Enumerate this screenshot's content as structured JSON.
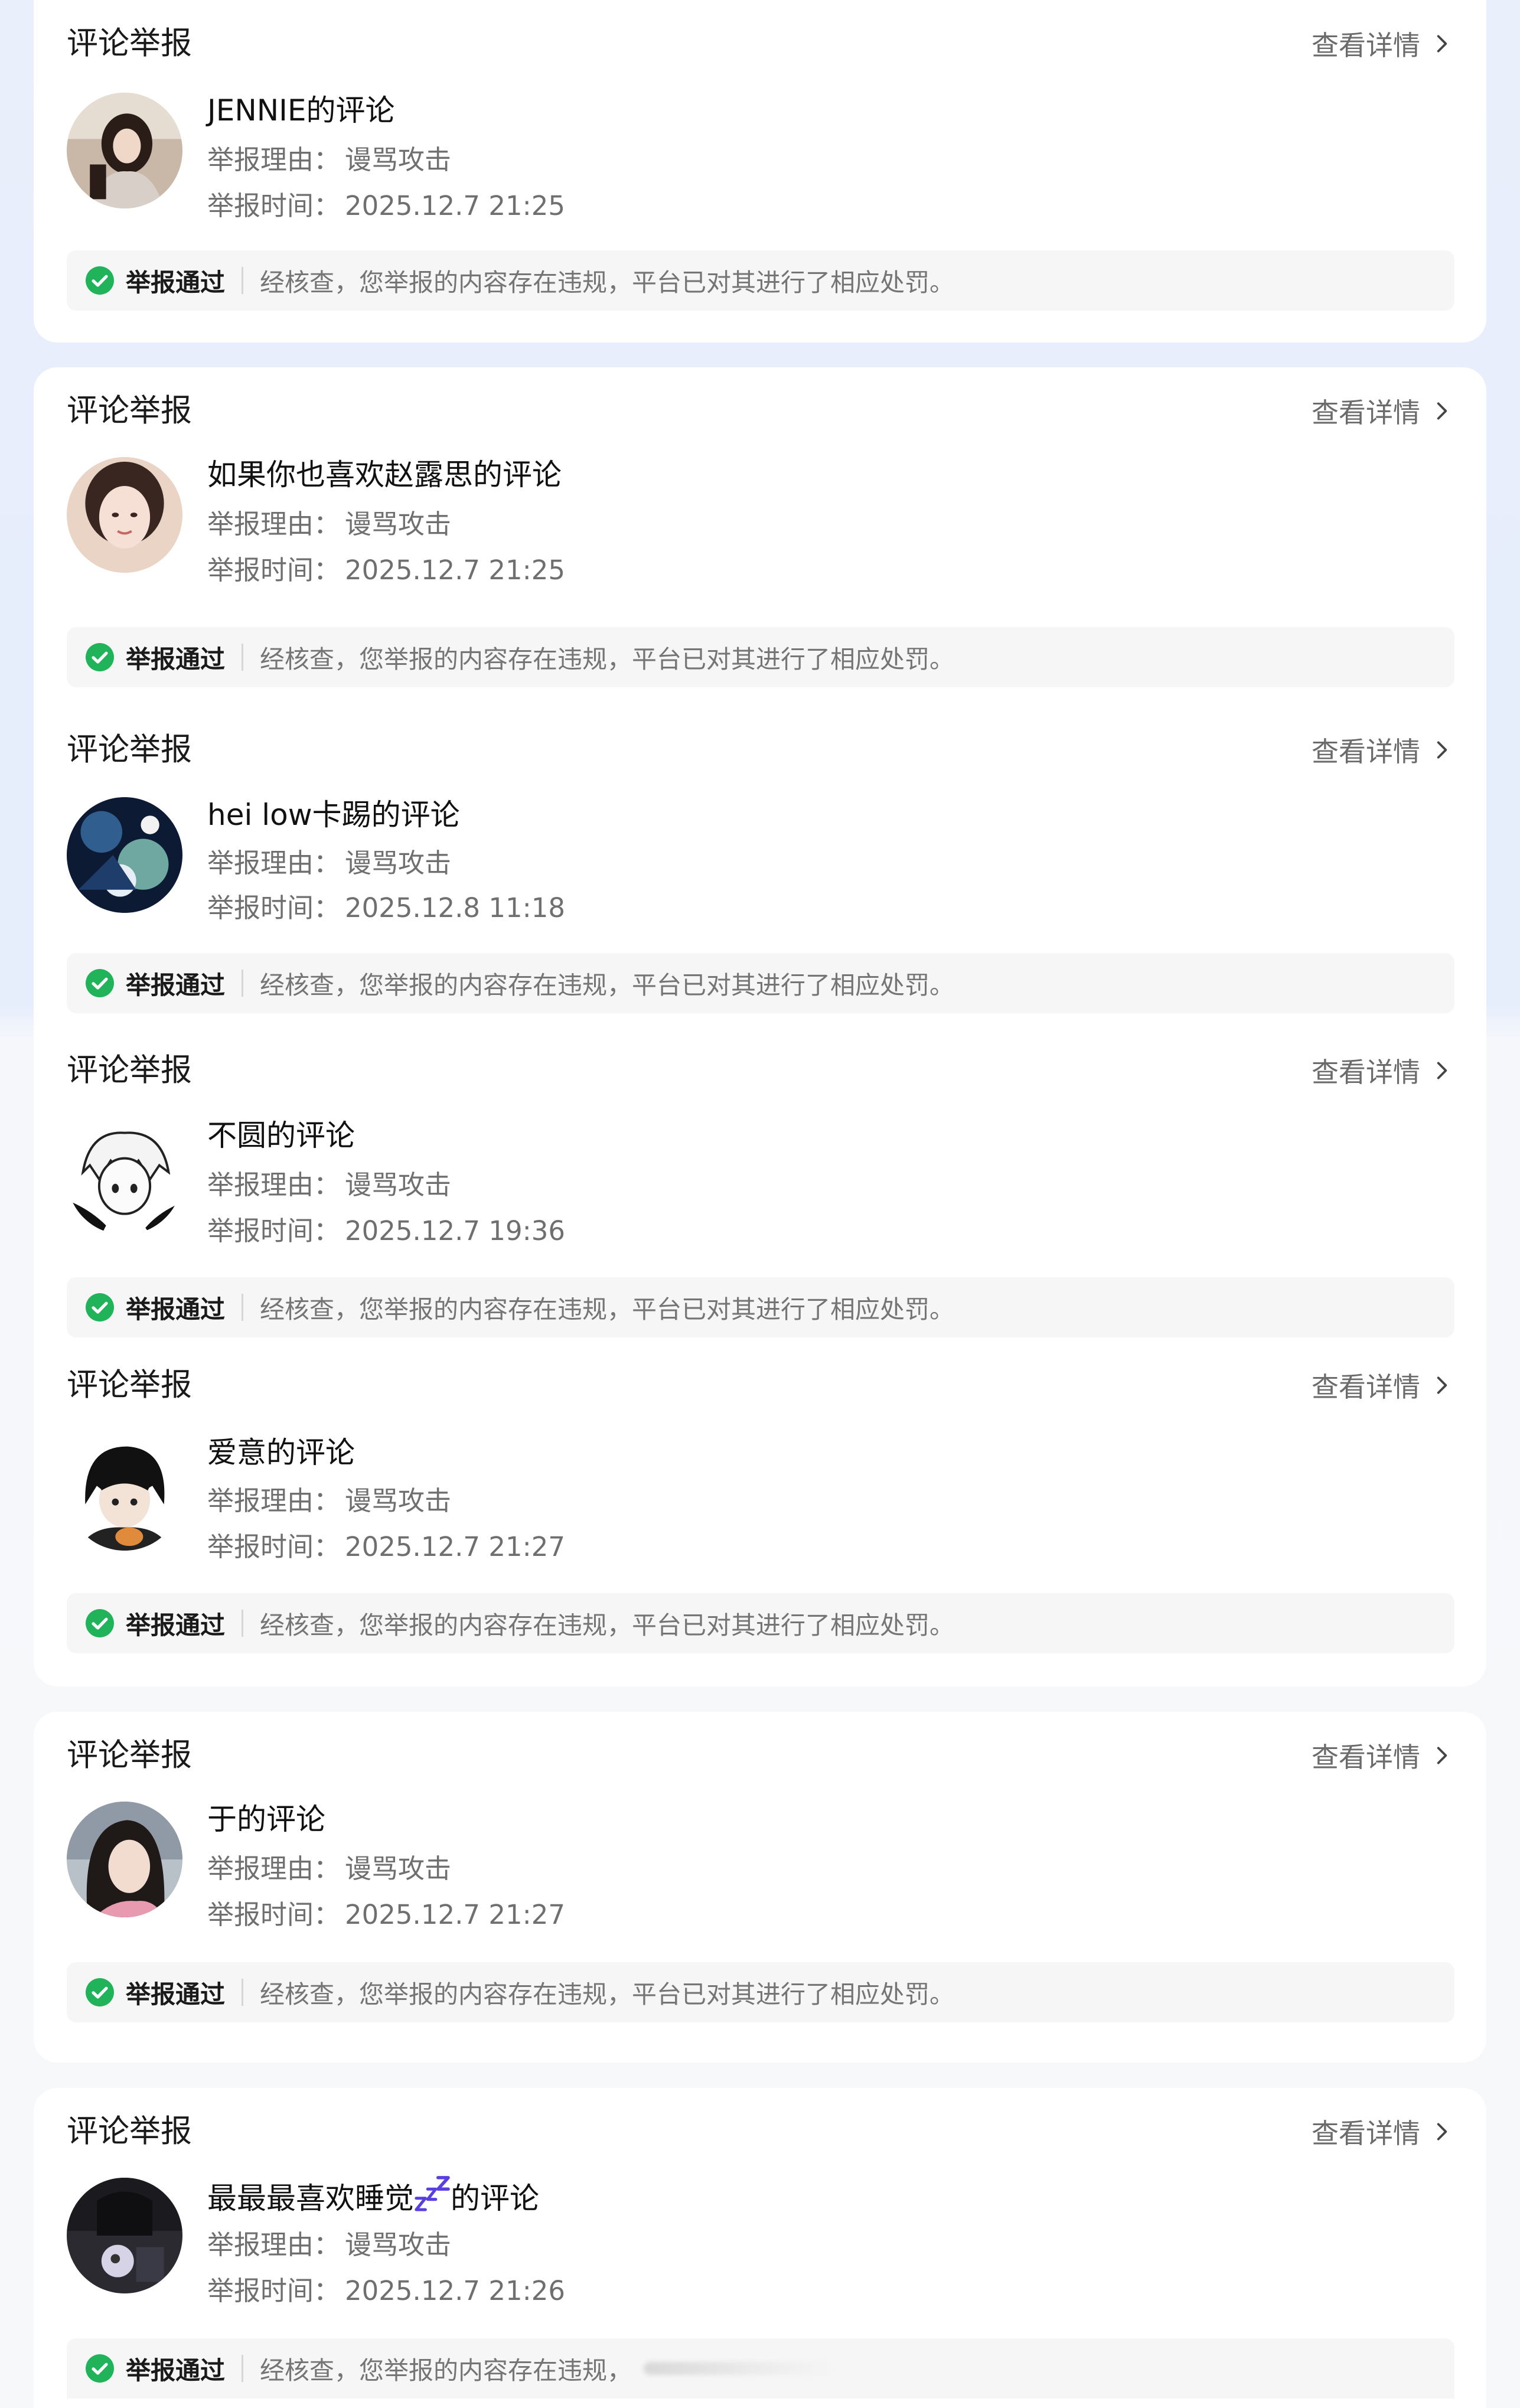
{
  "reports": [
    {
      "title": "评论举报",
      "detail_label": "查看详情",
      "commenter": "JENNIE的评论",
      "reason_label": "举报理由：",
      "reason": "谩骂攻击",
      "time_label": "举报时间：",
      "time": "2025.12.7 21:25",
      "status": "举报通过",
      "message": "经核查，您举报的内容存在违规，平台已对其进行了相应处罚。"
    },
    {
      "title": "评论举报",
      "detail_label": "查看详情",
      "commenter": "如果你也喜欢赵露思的评论",
      "reason_label": "举报理由：",
      "reason": "谩骂攻击",
      "time_label": "举报时间：",
      "time": "2025.12.7 21:25",
      "status": "举报通过",
      "message": "经核查，您举报的内容存在违规，平台已对其进行了相应处罚。"
    },
    {
      "title": "评论举报",
      "detail_label": "查看详情",
      "commenter": "hei low卡踢的评论",
      "reason_label": "举报理由：",
      "reason": "谩骂攻击",
      "time_label": "举报时间：",
      "time": "2025.12.8 11:18",
      "status": "举报通过",
      "message": "经核查，您举报的内容存在违规，平台已对其进行了相应处罚。"
    },
    {
      "title": "评论举报",
      "detail_label": "查看详情",
      "commenter": "不圆的评论",
      "reason_label": "举报理由：",
      "reason": "谩骂攻击",
      "time_label": "举报时间：",
      "time": "2025.12.7 19:36",
      "status": "举报通过",
      "message": "经核查，您举报的内容存在违规，平台已对其进行了相应处罚。"
    },
    {
      "title": "评论举报",
      "detail_label": "查看详情",
      "commenter": "爱意的评论",
      "reason_label": "举报理由：",
      "reason": "谩骂攻击",
      "time_label": "举报时间：",
      "time": "2025.12.7 21:27",
      "status": "举报通过",
      "message": "经核查，您举报的内容存在违规，平台已对其进行了相应处罚。"
    },
    {
      "title": "评论举报",
      "detail_label": "查看详情",
      "commenter": "于的评论",
      "reason_label": "举报理由：",
      "reason": "谩骂攻击",
      "time_label": "举报时间：",
      "time": "2025.12.7 21:27",
      "status": "举报通过",
      "message": "经核查，您举报的内容存在违规，平台已对其进行了相应处罚。"
    },
    {
      "title": "评论举报",
      "detail_label": "查看详情",
      "commenter_prefix": "最最最喜欢睡觉",
      "commenter_icon": "zzz-sleep-icon",
      "commenter_suffix": "的评论",
      "reason_label": "举报理由：",
      "reason": "谩骂攻击",
      "time_label": "举报时间：",
      "time": "2025.12.7 21:26",
      "status": "举报通过",
      "message": "经核查，您举报的内容存在违规，"
    }
  ],
  "colors": {
    "card_bg": "#ffffff",
    "status_ok": "#21b35a",
    "muted_text": "#6f6f6f",
    "status_bar_bg": "#f6f6f6",
    "zzz_icon": "#5a3fe0"
  },
  "icons": {
    "detail": "chevron-right-icon",
    "status": "check-circle-icon"
  }
}
